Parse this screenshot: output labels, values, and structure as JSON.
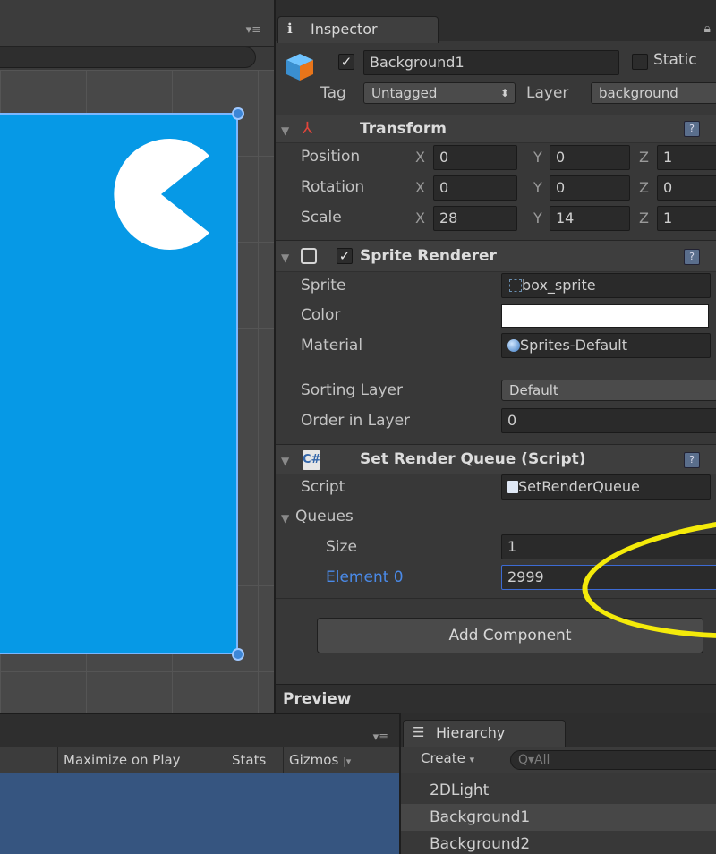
{
  "scene": {
    "menu_icon": "panel-menu-icon"
  },
  "inspector": {
    "tab_label": "Inspector",
    "tab_icon": "info-icon",
    "gameobject": {
      "name": "Background1",
      "active_check": "✓",
      "static_label": "Static",
      "tag_label": "Tag",
      "tag_value": "Untagged",
      "layer_label": "Layer",
      "layer_value": "background"
    },
    "transform": {
      "title": "Transform",
      "rows": [
        {
          "label": "Position",
          "x": "0",
          "y": "0",
          "z": "1"
        },
        {
          "label": "Rotation",
          "x": "0",
          "y": "0",
          "z": "0"
        },
        {
          "label": "Scale",
          "x": "28",
          "y": "14",
          "z": "1"
        }
      ],
      "axis_x": "X",
      "axis_y": "Y",
      "axis_z": "Z"
    },
    "sprite_renderer": {
      "title": "Sprite Renderer",
      "enabled_check": "✓",
      "sprite_label": "Sprite",
      "sprite_value": "box_sprite",
      "color_label": "Color",
      "color_value": "#ffffff",
      "material_label": "Material",
      "material_value": "Sprites-Default",
      "sorting_layer_label": "Sorting Layer",
      "sorting_layer_value": "Default",
      "order_label": "Order in Layer",
      "order_value": "0"
    },
    "script_component": {
      "title": "Set Render Queue (Script)",
      "script_label": "Script",
      "script_value": "SetRenderQueue",
      "queues_label": "Queues",
      "size_label": "Size",
      "size_value": "1",
      "element_label": "Element 0",
      "element_value": "2999"
    },
    "add_component_label": "Add Component",
    "preview_label": "Preview"
  },
  "game_view": {
    "tools": [
      "Maximize on Play",
      "Stats",
      "Gizmos"
    ]
  },
  "hierarchy": {
    "tab_label": "Hierarchy",
    "create_label": "Create",
    "search_placeholder": "Q▾All",
    "items": [
      "2DLight",
      "Background1",
      "Background2"
    ],
    "selected_index": 1
  },
  "colors": {
    "sprite_blue": "#0699e6",
    "highlight_yellow": "#f4ea0a",
    "element_label_blue": "#4a8ae8",
    "game_bg": "#365580"
  }
}
